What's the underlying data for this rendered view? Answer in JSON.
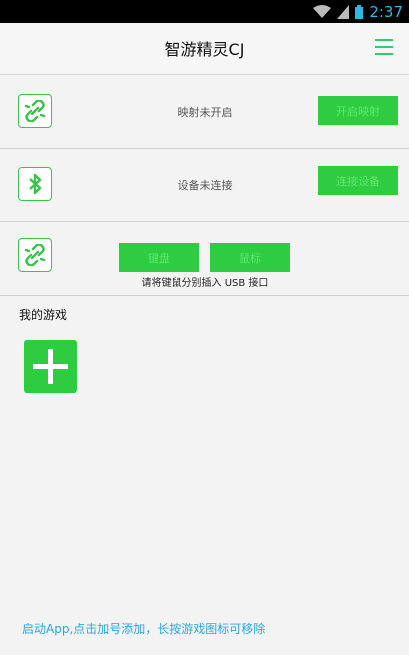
{
  "status_bar": {
    "time": "2:37"
  },
  "header": {
    "title": "智游精灵CJ",
    "menu_icon": "menu-icon"
  },
  "colors": {
    "accent_green": "#2ecc40",
    "icon_border": "#3cc14a",
    "tip_blue": "#29a9e0"
  },
  "rows": [
    {
      "icon": "link-broken-icon",
      "status": "映射未开启",
      "button": "开启映射"
    },
    {
      "icon": "bluetooth-icon",
      "status": "设备未连接",
      "button": "连接设备"
    },
    {
      "icon": "link-broken-icon",
      "buttons": [
        "键盘",
        "鼠标"
      ],
      "hint": "请将键鼠分别插入 USB 接口"
    }
  ],
  "games": {
    "title": "我的游戏",
    "add_icon": "plus-icon"
  },
  "footer": {
    "tip": "启动App,点击加号添加，长按游戏图标可移除"
  }
}
